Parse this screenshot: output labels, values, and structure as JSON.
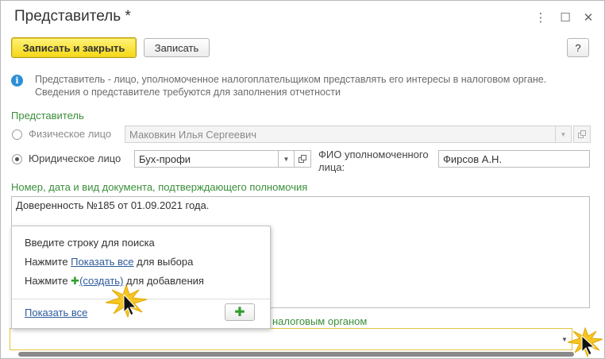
{
  "window": {
    "title": "Представитель *",
    "controls": {
      "more": "⋮",
      "maximize": "☐",
      "close": "✕"
    }
  },
  "toolbar": {
    "save_close_label": "Записать и закрыть",
    "save_label": "Записать",
    "help_label": "?"
  },
  "info": {
    "text": "Представитель - лицо, уполномоченное налогоплательщиком представлять его интересы в налоговом органе. Сведения о представителе требуются для заполнения отчетности"
  },
  "representative": {
    "group_label": "Представитель",
    "individual": {
      "label": "Физическое лицо",
      "value": "Маковкин Илья Сергеевич",
      "selected": false
    },
    "legal": {
      "label": "Юридическое лицо",
      "value": "Бух-профи",
      "selected": true
    },
    "authorized_person_label_1": "ФИО уполномоченного",
    "authorized_person_label_2": "лица:",
    "authorized_person_value": "Фирсов А.Н."
  },
  "document": {
    "label": "Номер, дата и вид документа, подтверждающего полномочия",
    "value": "Доверенность №185 от 01.09.2021 года."
  },
  "tax_authority": {
    "label_partial": "налоговым органом",
    "value": ""
  },
  "popup": {
    "line1": "Введите строку для поиска",
    "line2_prefix": "Нажмите ",
    "line2_link": "Показать все",
    "line2_suffix": " для выбора",
    "line3_prefix": "Нажмите ",
    "line3_plus": "✚",
    "line3_link": "(создать)",
    "line3_suffix": " для добавления",
    "show_all_link": "Показать все",
    "add_button": "✚"
  },
  "colors": {
    "accent_green": "#3b8f3b",
    "primary_yellow": "#f5d814",
    "link_blue": "#2e5a9c",
    "info_blue": "#2c8fd6"
  }
}
